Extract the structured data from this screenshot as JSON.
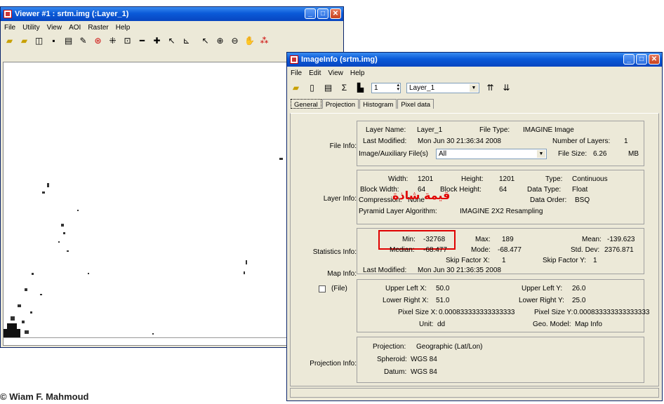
{
  "viewer": {
    "title": "Viewer #1 : srtm.img (:Layer_1)",
    "menu": [
      "File",
      "Utility",
      "View",
      "AOI",
      "Raster",
      "Help"
    ]
  },
  "imageinfo": {
    "title": "ImageInfo (srtm.img)",
    "menu": [
      "File",
      "Edit",
      "View",
      "Help"
    ],
    "layer_number": "1",
    "layer_select": "Layer_1",
    "tabs": [
      "General",
      "Projection",
      "Histogram",
      "Pixel data"
    ],
    "file_info": {
      "label": "File Info:",
      "layer_name_label": "Layer Name:",
      "layer_name": "Layer_1",
      "file_type_label": "File Type:",
      "file_type": "IMAGINE Image",
      "last_modified_label": "Last Modified:",
      "last_modified": "Mon Jun 30 21:36:34 2008",
      "num_layers_label": "Number of Layers:",
      "num_layers": "1",
      "aux_label": "Image/Auxiliary File(s)",
      "aux_value": "All",
      "file_size_label": "File Size:",
      "file_size": "6.26",
      "file_size_unit": "MB"
    },
    "layer_info": {
      "label": "Layer Info:",
      "width_label": "Width:",
      "width": "1201",
      "height_label": "Height:",
      "height": "1201",
      "type_label": "Type:",
      "type": "Continuous",
      "block_width_label": "Block Width:",
      "block_width": "64",
      "block_height_label": "Block Height:",
      "block_height": "64",
      "data_type_label": "Data Type:",
      "data_type": "Float",
      "compression_label": "Compression:",
      "compression": "None",
      "data_order_label": "Data Order:",
      "data_order": "BSQ",
      "pyramid_label": "Pyramid Layer Algorithm:",
      "pyramid": "IMAGINE 2X2 Resampling"
    },
    "statistics_info": {
      "label": "Statistics Info:",
      "min_label": "Min:",
      "min": "-32768",
      "max_label": "Max:",
      "max": "189",
      "mean_label": "Mean:",
      "mean": "-139.623",
      "median_label": "Median:",
      "median": "-68.477",
      "mode_label": "Mode:",
      "mode": "-68.477",
      "std_label": "Std. Dev:",
      "std": "2376.871",
      "skipx_label": "Skip Factor X:",
      "skipx": "1",
      "skipy_label": "Skip Factor Y:",
      "skipy": "1",
      "last_modified_label": "Last Modified:",
      "last_modified": "Mon Jun 30 21:36:35 2008"
    },
    "map_info": {
      "label": "Map Info:",
      "file_checkbox": "(File)",
      "ulx_label": "Upper Left X:",
      "ulx": "50.0",
      "uly_label": "Upper Left Y:",
      "uly": "26.0",
      "lrx_label": "Lower Right X:",
      "lrx": "51.0",
      "lry_label": "Lower Right Y:",
      "lry": "25.0",
      "psx_label": "Pixel Size X:",
      "psx": "0.000833333333333333",
      "psy_label": "Pixel Size Y:",
      "psy": "0.000833333333333333",
      "unit_label": "Unit:",
      "unit": "dd",
      "geo_label": "Geo. Model:",
      "geo": "Map Info"
    },
    "projection_info": {
      "label": "Projection Info:",
      "projection_label": "Projection:",
      "projection": "Geographic (Lat/Lon)",
      "spheroid_label": "Spheroid:",
      "spheroid": "WGS 84",
      "datum_label": "Datum:",
      "datum": "WGS 84"
    },
    "annotation": "قيمة شاذة"
  },
  "caption": "© Wiam F. Mahmoud"
}
